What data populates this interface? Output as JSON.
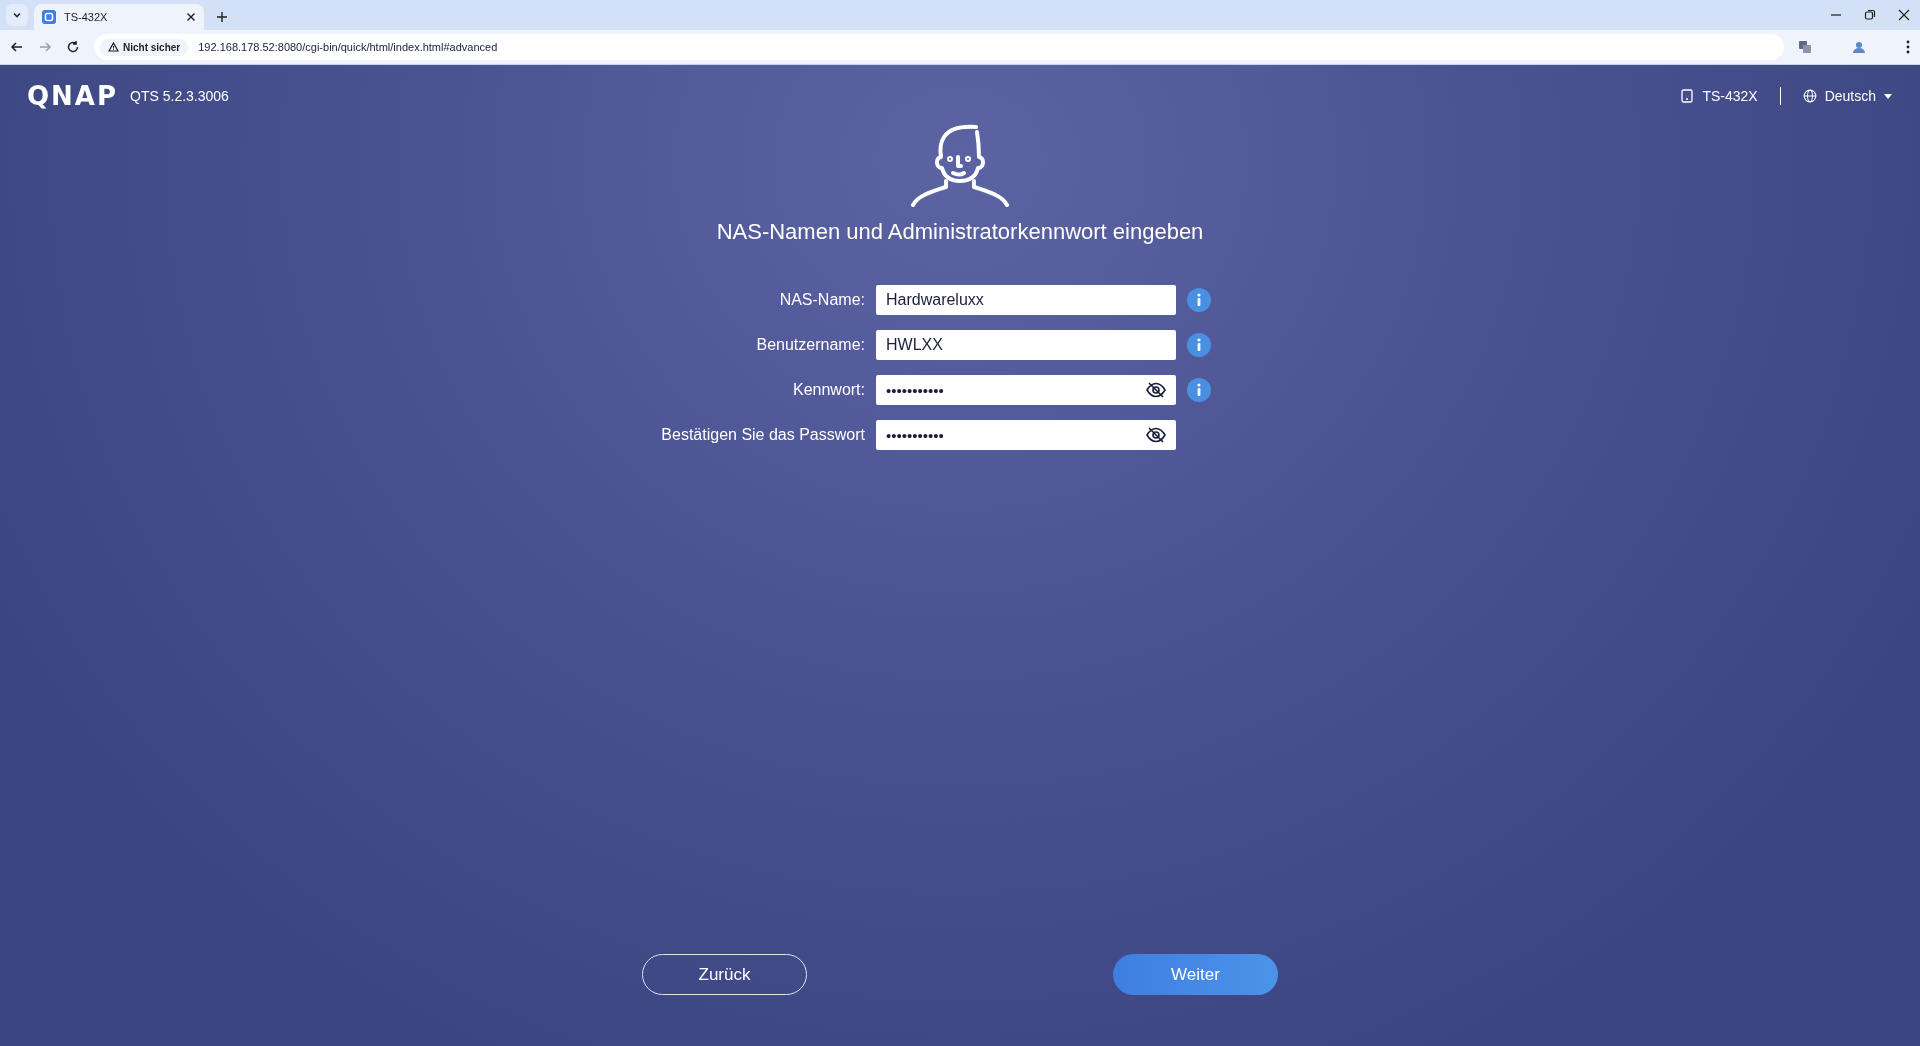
{
  "browser": {
    "tabs": [
      {
        "title": "TS-432X",
        "selected": true
      }
    ],
    "security": "Nicht sicher",
    "url": "192.168.178.52:8080/cgi-bin/quick/html/index.html#advanced"
  },
  "header": {
    "logo": "QNAP",
    "version": "QTS 5.2.3.3006",
    "device": "TS-432X",
    "language": "Deutsch"
  },
  "title": "NAS-Namen und Administratorkennwort eingeben",
  "fields": [
    {
      "label": "NAS-Name:",
      "value": "Hardwareluxx",
      "kind": "text",
      "info": true
    },
    {
      "label": "Benutzername:",
      "value": "HWLXX",
      "kind": "text",
      "info": true
    },
    {
      "label": "Kennwort:",
      "value": "•••••••••••",
      "kind": "password",
      "info": true
    },
    {
      "label": "Bestätigen Sie das Passwort",
      "value": "•••••••••••",
      "kind": "password",
      "info": false
    }
  ],
  "buttons": [
    {
      "label": "Zurück",
      "kind": "secondary"
    },
    {
      "label": "Weiter",
      "kind": "primary"
    }
  ]
}
